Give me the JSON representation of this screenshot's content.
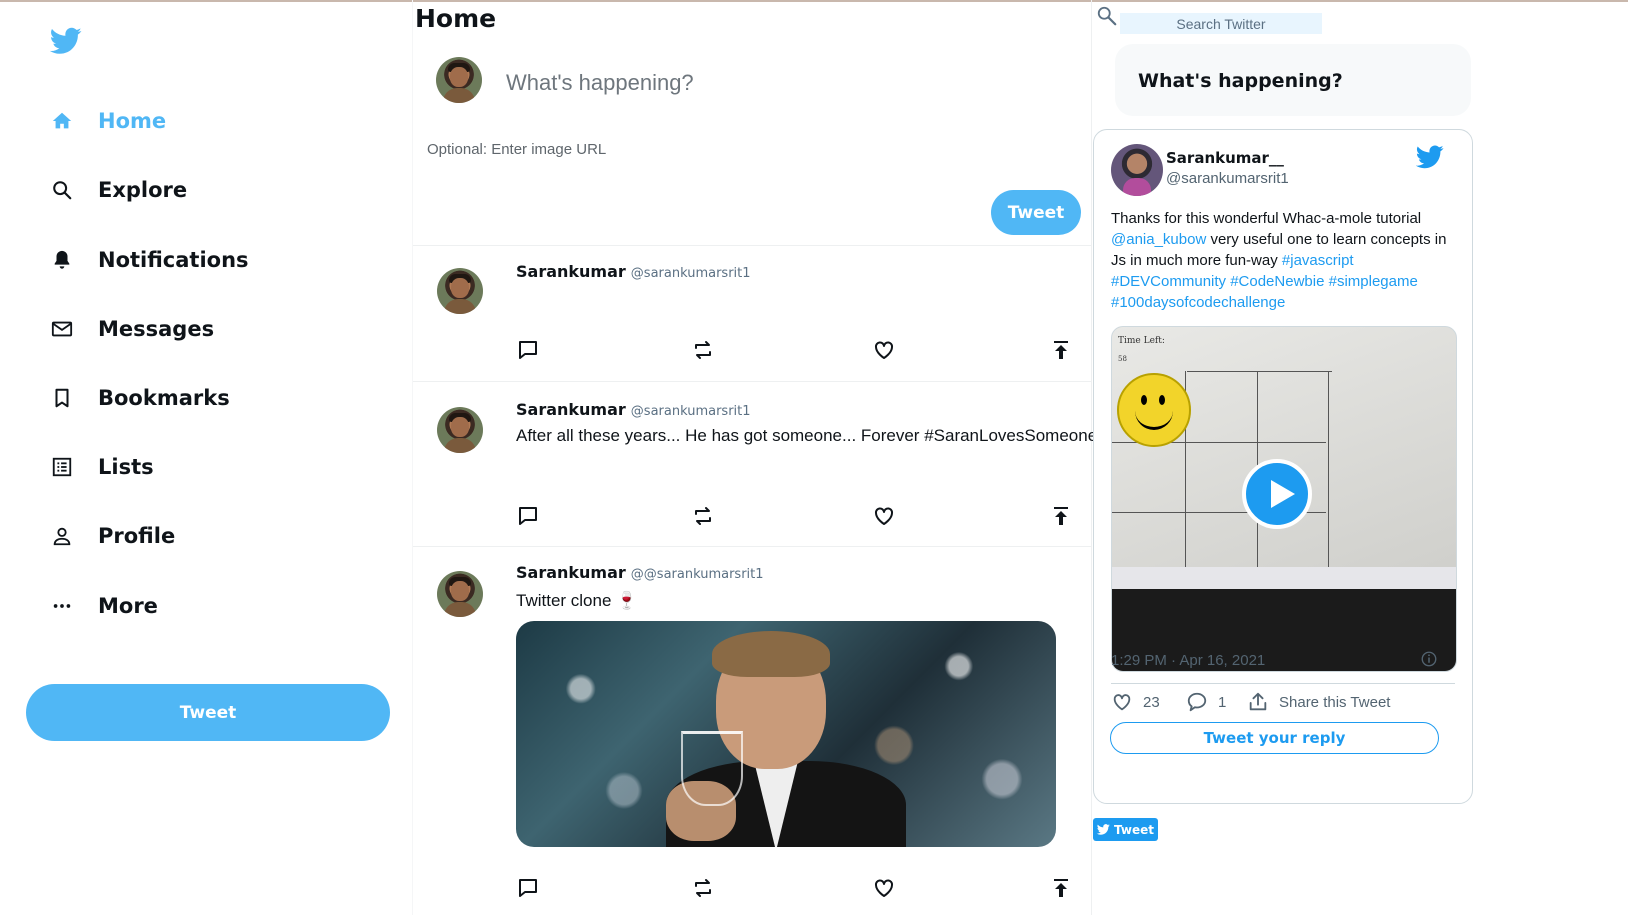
{
  "sidebar": {
    "logo_icon": "twitter-bird-icon",
    "items": [
      {
        "label": "Home",
        "icon": "home-icon"
      },
      {
        "label": "Explore",
        "icon": "search-icon"
      },
      {
        "label": "Notifications",
        "icon": "bell-icon"
      },
      {
        "label": "Messages",
        "icon": "mail-icon"
      },
      {
        "label": "Bookmarks",
        "icon": "bookmark-icon"
      },
      {
        "label": "Lists",
        "icon": "list-icon"
      },
      {
        "label": "Profile",
        "icon": "person-icon"
      },
      {
        "label": "More",
        "icon": "more-icon"
      }
    ],
    "tweet_label": "Tweet"
  },
  "feed": {
    "title": "Home",
    "compose": {
      "placeholder": "What's happening?",
      "image_placeholder": "Optional: Enter image URL",
      "tweet_label": "Tweet"
    },
    "posts": [
      {
        "name": "Sarankumar",
        "handle": "@sarankumarsrit1",
        "text": ""
      },
      {
        "name": "Sarankumar",
        "handle": "@sarankumarsrit1",
        "text": "After all these years... He has got someone... Forever #SaranLovesSomeone"
      },
      {
        "name": "Sarankumar",
        "handle": "@@sarankumarsrit1",
        "text": "Twitter clone 🍷",
        "has_gif": true
      }
    ]
  },
  "right": {
    "search": {
      "placeholder": "Search Twitter"
    },
    "happening_title": "What's happening?",
    "embed": {
      "name": "Sarankumar__",
      "handle": "@sarankumarsrit1",
      "text_intro": "Thanks for this wonderful Whac-a-mole tutorial ",
      "mention": "@ania_kubow",
      "text_mid": " very useful one to learn concepts in Js in much more fun-way ",
      "hashtags": "#javascript #DEVCommunity #CodeNewbie #simplegame #100daysofcodechallenge",
      "media_time_label": "Time Left:",
      "media_time_value": "58",
      "timestamp": "1:29 PM · Apr 16, 2021",
      "likes": "23",
      "replies": "1",
      "share_label": "Share this Tweet",
      "reply_label": "Tweet your reply"
    },
    "tweet_button_label": "Tweet"
  },
  "colors": {
    "accent": "#50b7f5",
    "link": "#1d9bf0",
    "text": "#0f1419",
    "muted": "#5b7083"
  }
}
